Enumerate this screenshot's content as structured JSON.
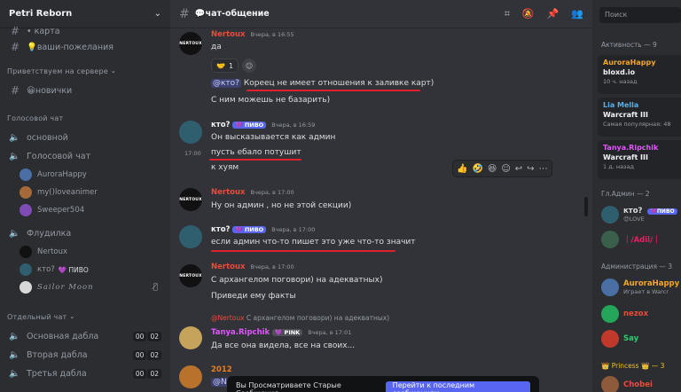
{
  "server": {
    "name": "Petri Reborn"
  },
  "sidebar": {
    "top_partial": "• карта",
    "wishes_channel": "💡ваши-пожелания",
    "cat_welcome": "Приветствуем на сервере",
    "newbies_channel": "😀новички",
    "cat_voice": "Голосовой чат",
    "voice_main": "основной",
    "voice_voicechat": "Голосовой чат",
    "voice_users": [
      "AuroraHappy",
      "my()loveanimer",
      "Sweeper504"
    ],
    "voice_flood": "Флудилка",
    "flood_users": [
      "Nertoux",
      "кто?",
      "Sailor Moon"
    ],
    "flood_pivo": "💜 ПИВО",
    "cat_separate": "Отдельный чат",
    "voice_rooms": [
      {
        "name": "Основная дабла",
        "a": "00",
        "b": "02"
      },
      {
        "name": "Вторая дабла",
        "a": "00",
        "b": "02"
      },
      {
        "name": "Третья дабла",
        "a": "00",
        "b": "02"
      }
    ]
  },
  "chat": {
    "channel_title": "💬чат-общение",
    "messages": {
      "m1": {
        "author": "Nertoux",
        "time": "Вчера, в 16:55",
        "line1": "да",
        "reaction_count": "1",
        "mention": "@кто?",
        "line2": "Кореец не имеет отношения к заливке карт)",
        "line3": "С ним можешь не базарить)"
      },
      "m2": {
        "author": "кто?",
        "badge": "💜 ПИВО",
        "time": "Вчера, в 16:59",
        "line1": "Он высказывается как админ",
        "side_time": "17:00",
        "line2": "пусть ебало потушит",
        "line3": "к хуям"
      },
      "m3": {
        "author": "Nertoux",
        "time": "Вчера, в 17:00",
        "line1": "Ну он админ , но не этой секции)"
      },
      "m4": {
        "author": "кто?",
        "badge": "💜 ПИВО",
        "time": "Вчера, в 17:00",
        "line1": "если админ что-то пишет это уже что-то  значит"
      },
      "m5": {
        "author": "Nertoux",
        "time": "Вчера, в 17:00",
        "line1": "С архангелом поговори) на адекватных)",
        "line2": "Приведи ему факты"
      },
      "m6": {
        "reply_author": "@Nertoux",
        "reply_text": "С архангелом поговори) на адекватных)",
        "author": "Tanya.Ripchik",
        "badge": "💜 PINK",
        "time": "Вчера, в 17:01",
        "line1": "Да все она видела, все на своих..."
      },
      "m7": {
        "author": "2012",
        "mention": "@Nertoux"
      }
    },
    "banner": {
      "text": "Вы Просматриваете Старые Сообщения",
      "button": "Перейти к последним сообщениям"
    }
  },
  "members": {
    "search_placeholder": "Поиск",
    "activity_header": "Активность — 9",
    "activities": [
      {
        "name": "AuroraHappy",
        "game": "bloxd.io",
        "sub": "10 ч. назад",
        "color": "#f5a623"
      },
      {
        "name": "Lia Mella",
        "game": "Warcraft III",
        "sub": "Самая популярная: 48",
        "color": "#5dade2"
      },
      {
        "name": "Tanya.Ripchik",
        "game": "Warcraft III",
        "sub": "1 д. назад",
        "color": "#e056fd"
      }
    ],
    "admin_header": "Гл.Админ — 2",
    "admins": [
      {
        "name": "кто?",
        "badge": "💜ПИВО",
        "sub": "😍LOVE"
      },
      {
        "name": "｜/Adil/｜",
        "sub": ""
      }
    ],
    "adminstration_header": "Администрация — 3",
    "adminstration": [
      {
        "name": "AuroraHappy",
        "sub": "Играет в Warcr"
      },
      {
        "name": "nezox",
        "sub": ""
      },
      {
        "name": "Say",
        "sub": ""
      }
    ],
    "princess_header": "👑 Princess 👑 — 3",
    "princess": [
      {
        "name": "Chobei"
      }
    ]
  },
  "colors": {
    "accent": "#5865f2",
    "nertoux": "#e74c3c",
    "tanya": "#e056fd",
    "aurora": "#f5a623",
    "green": "#2ecc71",
    "redline": "#e0212d"
  }
}
